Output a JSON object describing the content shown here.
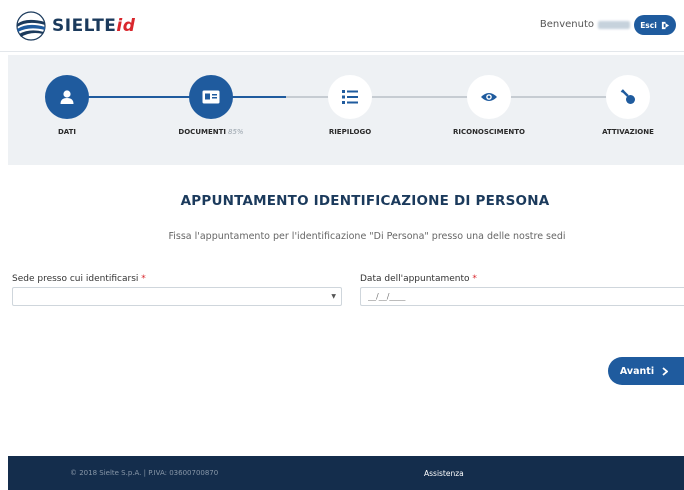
{
  "header": {
    "logo_text": "SIELTE",
    "logo_suffix": "id",
    "welcome_label": "Benvenuto",
    "logout_label": "Esci"
  },
  "stepper": {
    "steps": [
      {
        "label": "DATI",
        "icon": "user-icon",
        "state": "active"
      },
      {
        "label": "DOCUMENTI",
        "progress_label": "85%",
        "progress": 0.85,
        "icon": "id-card-icon",
        "state": "active"
      },
      {
        "label": "RIEPILOGO",
        "icon": "list-icon",
        "state": "inactive"
      },
      {
        "label": "RICONOSCIMENTO",
        "icon": "eye-icon",
        "state": "inactive"
      },
      {
        "label": "ATTIVAZIONE",
        "icon": "key-icon",
        "state": "inactive"
      }
    ]
  },
  "main": {
    "title": "APPUNTAMENTO IDENTIFICAZIONE DI PERSONA",
    "subtitle": "Fissa l'appuntamento per l'identificazione \"Di Persona\" presso una delle nostre sedi",
    "location_label": "Sede presso cui identificarsi",
    "location_value": "",
    "date_label": "Data dell'appuntamento",
    "date_placeholder": "__/__/____",
    "required_mark": "*",
    "next_label": "Avanti"
  },
  "footer": {
    "copyright": "© 2018 Sielte S.p.A. | P.IVA: 03600700870",
    "assist_label": "Assistenza"
  },
  "colors": {
    "primary": "#1f5b9e",
    "navy": "#1b3a5c",
    "footer_bg": "#142d4c",
    "stepper_bg": "#eef1f4",
    "required": "#d9262c"
  }
}
